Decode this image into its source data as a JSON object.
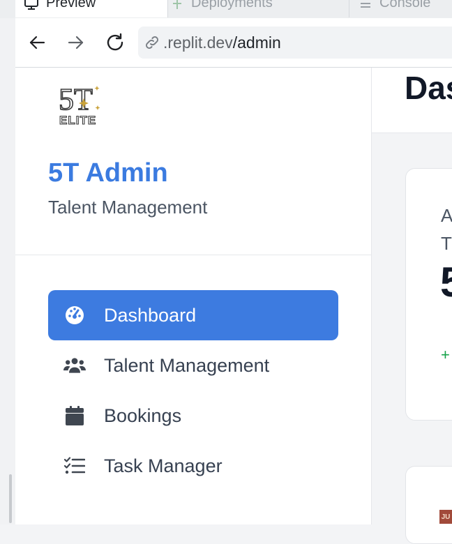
{
  "browser": {
    "tabs": [
      {
        "label": "Preview",
        "icon": "monitor-icon",
        "active": true
      },
      {
        "label": "Deployments",
        "icon": "deploy-icon",
        "active": false
      },
      {
        "label": "Console",
        "icon": "console-icon",
        "active": false
      }
    ],
    "url_prefix": ".replit.dev",
    "url_path": "/admin"
  },
  "sidebar": {
    "logo_text_top": "5T",
    "logo_text_bottom": "ELITE",
    "title": "5T Admin",
    "subtitle": "Talent Management",
    "items": [
      {
        "label": "Dashboard",
        "icon": "dashboard-gauge-icon",
        "active": true
      },
      {
        "label": "Talent Management",
        "icon": "users-icon",
        "active": false
      },
      {
        "label": "Bookings",
        "icon": "calendar-icon",
        "active": false
      },
      {
        "label": "Task Manager",
        "icon": "task-list-icon",
        "active": false
      }
    ]
  },
  "main": {
    "title": "Das",
    "card1": {
      "line1": "A",
      "line2": "T",
      "value": "5",
      "delta": "+"
    },
    "card2": {
      "logo_text": "JU"
    }
  },
  "colors": {
    "accent": "#3d7be0",
    "brand_title": "#3b7be0",
    "positive": "#16a34a"
  }
}
